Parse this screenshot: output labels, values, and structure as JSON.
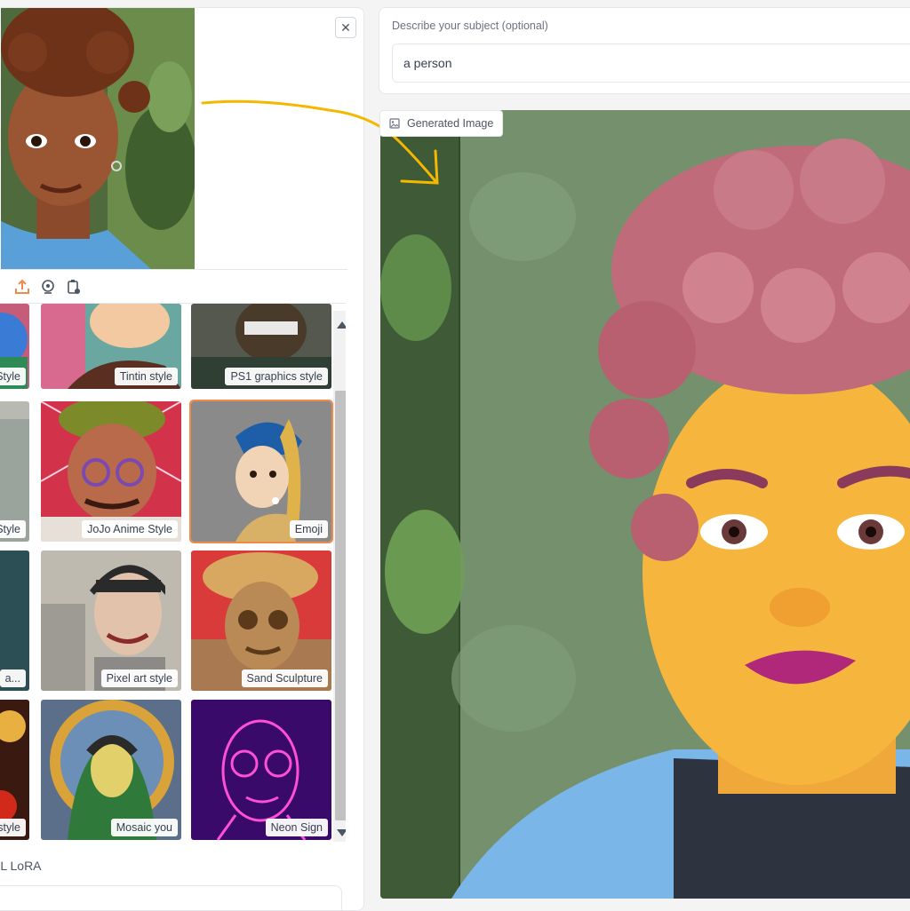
{
  "input_image": {
    "alt": "Uploaded portrait",
    "close_icon": "close-icon"
  },
  "toolbar": {
    "icons": [
      "upload-icon",
      "webcam-icon",
      "clipboard-icon"
    ]
  },
  "gallery": {
    "items": [
      {
        "label": "Style"
      },
      {
        "label": "Tintin style"
      },
      {
        "label": "PS1 graphics style"
      },
      {
        "label": "Style"
      },
      {
        "label": "JoJo Anime Style"
      },
      {
        "label": "Emoji"
      },
      {
        "label": "a..."
      },
      {
        "label": "Pixel art style"
      },
      {
        "label": "Sand Sculpture"
      },
      {
        "label": "style"
      },
      {
        "label": "Mosaic you"
      },
      {
        "label": "Neon Sign"
      }
    ],
    "selected": "Emoji"
  },
  "lora": {
    "label": "XL LoRA"
  },
  "subject": {
    "label": "Describe your subject (optional)",
    "value": "a person"
  },
  "output": {
    "badge_label": "Generated Image",
    "badge_icon": "image-icon"
  },
  "colors": {
    "accent": "#f08a4b",
    "arrow": "#f5b800"
  }
}
